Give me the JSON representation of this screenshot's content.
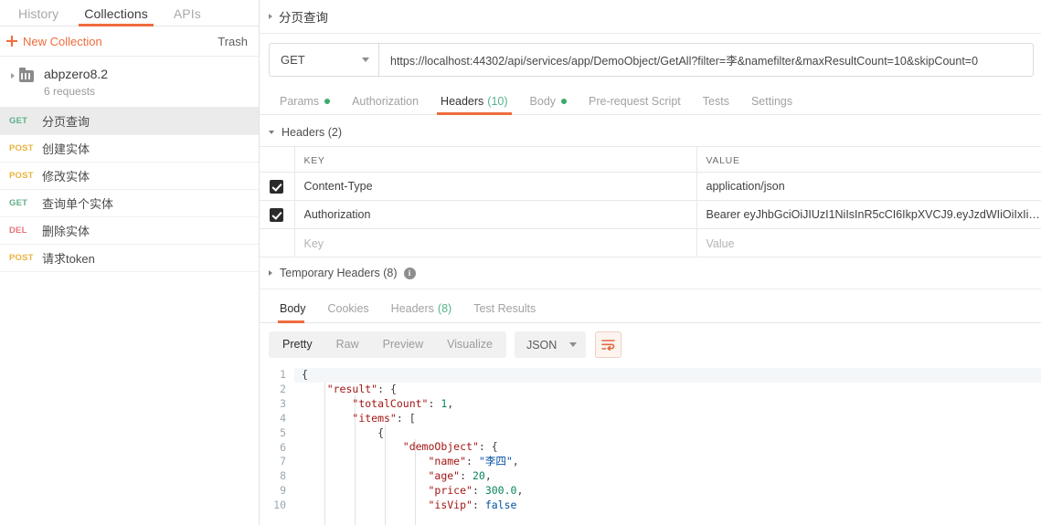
{
  "sidebar": {
    "tabs": [
      {
        "label": "History",
        "active": false
      },
      {
        "label": "Collections",
        "active": true
      },
      {
        "label": "APIs",
        "active": false
      }
    ],
    "new_collection_label": "New Collection",
    "trash_label": "Trash",
    "collection": {
      "name": "abpzero8.2",
      "requests_count_label": "6 requests"
    },
    "requests": [
      {
        "method": "GET",
        "name": "分页查询",
        "selected": true
      },
      {
        "method": "POST",
        "name": "创建实体",
        "selected": false
      },
      {
        "method": "POST",
        "name": "修改实体",
        "selected": false
      },
      {
        "method": "GET",
        "name": "查询单个实体",
        "selected": false
      },
      {
        "method": "DEL",
        "name": "删除实体",
        "selected": false
      },
      {
        "method": "POST",
        "name": "请求token",
        "selected": false
      }
    ]
  },
  "request": {
    "title": "分页查询",
    "method": "GET",
    "url": "https://localhost:44302/api/services/app/DemoObject/GetAll?filter=李&namefilter&maxResultCount=10&skipCount=0",
    "tabs": [
      {
        "label": "Params",
        "dot": true,
        "count": "",
        "active": false
      },
      {
        "label": "Authorization",
        "dot": false,
        "count": "",
        "active": false
      },
      {
        "label": "Headers",
        "dot": false,
        "count": "(10)",
        "active": true
      },
      {
        "label": "Body",
        "dot": true,
        "count": "",
        "active": false
      },
      {
        "label": "Pre-request Script",
        "dot": false,
        "count": "",
        "active": false
      },
      {
        "label": "Tests",
        "dot": false,
        "count": "",
        "active": false
      },
      {
        "label": "Settings",
        "dot": false,
        "count": "",
        "active": false
      }
    ],
    "headers_section_label": "Headers (2)",
    "table": {
      "columns": [
        "KEY",
        "VALUE"
      ],
      "rows": [
        {
          "checked": true,
          "key": "Content-Type",
          "value": "application/json"
        },
        {
          "checked": true,
          "key": "Authorization",
          "value": "Bearer eyJhbGciOiJIUzI1NiIsInR5cCI6IkpXVCJ9.eyJzdWIiOiIxIiwibmFtZFtZ..."
        }
      ],
      "new_row": {
        "key_placeholder": "Key",
        "value_placeholder": "Value"
      }
    },
    "temporary_headers_label": "Temporary Headers (8)"
  },
  "response": {
    "tabs": [
      {
        "label": "Body",
        "count": "",
        "active": true
      },
      {
        "label": "Cookies",
        "count": "",
        "active": false
      },
      {
        "label": "Headers",
        "count": "(8)",
        "active": false
      },
      {
        "label": "Test Results",
        "count": "",
        "active": false
      }
    ],
    "format_tabs": [
      {
        "label": "Pretty",
        "active": true
      },
      {
        "label": "Raw",
        "active": false
      },
      {
        "label": "Preview",
        "active": false
      },
      {
        "label": "Visualize",
        "active": false
      }
    ],
    "language": "JSON",
    "body_lines": [
      {
        "n": "1",
        "tokens": [
          {
            "t": "{",
            "c": "p"
          }
        ]
      },
      {
        "n": "2",
        "indent": 4,
        "tokens": [
          {
            "t": "\"result\"",
            "c": "k"
          },
          {
            "t": ": {",
            "c": "p"
          }
        ]
      },
      {
        "n": "3",
        "indent": 8,
        "tokens": [
          {
            "t": "\"totalCount\"",
            "c": "k"
          },
          {
            "t": ": ",
            "c": "p"
          },
          {
            "t": "1",
            "c": "n"
          },
          {
            "t": ",",
            "c": "p"
          }
        ]
      },
      {
        "n": "4",
        "indent": 8,
        "tokens": [
          {
            "t": "\"items\"",
            "c": "k"
          },
          {
            "t": ": [",
            "c": "p"
          }
        ]
      },
      {
        "n": "5",
        "indent": 12,
        "tokens": [
          {
            "t": "{",
            "c": "p"
          }
        ]
      },
      {
        "n": "6",
        "indent": 16,
        "tokens": [
          {
            "t": "\"demoObject\"",
            "c": "k"
          },
          {
            "t": ": {",
            "c": "p"
          }
        ]
      },
      {
        "n": "7",
        "indent": 20,
        "tokens": [
          {
            "t": "\"name\"",
            "c": "k"
          },
          {
            "t": ": ",
            "c": "p"
          },
          {
            "t": "\"李四\"",
            "c": "s"
          },
          {
            "t": ",",
            "c": "p"
          }
        ]
      },
      {
        "n": "8",
        "indent": 20,
        "tokens": [
          {
            "t": "\"age\"",
            "c": "k"
          },
          {
            "t": ": ",
            "c": "p"
          },
          {
            "t": "20",
            "c": "n"
          },
          {
            "t": ",",
            "c": "p"
          }
        ]
      },
      {
        "n": "9",
        "indent": 20,
        "tokens": [
          {
            "t": "\"price\"",
            "c": "k"
          },
          {
            "t": ": ",
            "c": "p"
          },
          {
            "t": "300.0",
            "c": "n"
          },
          {
            "t": ",",
            "c": "p"
          }
        ]
      },
      {
        "n": "10",
        "indent": 20,
        "tokens": [
          {
            "t": "\"isVip\"",
            "c": "k"
          },
          {
            "t": ": ",
            "c": "p"
          },
          {
            "t": "false",
            "c": "b"
          }
        ]
      }
    ]
  },
  "colors": {
    "accent": "#ef6c3e",
    "get": "#5fb08a",
    "post": "#e8b33e",
    "del": "#e8747c",
    "dot": "#3fa96a"
  }
}
